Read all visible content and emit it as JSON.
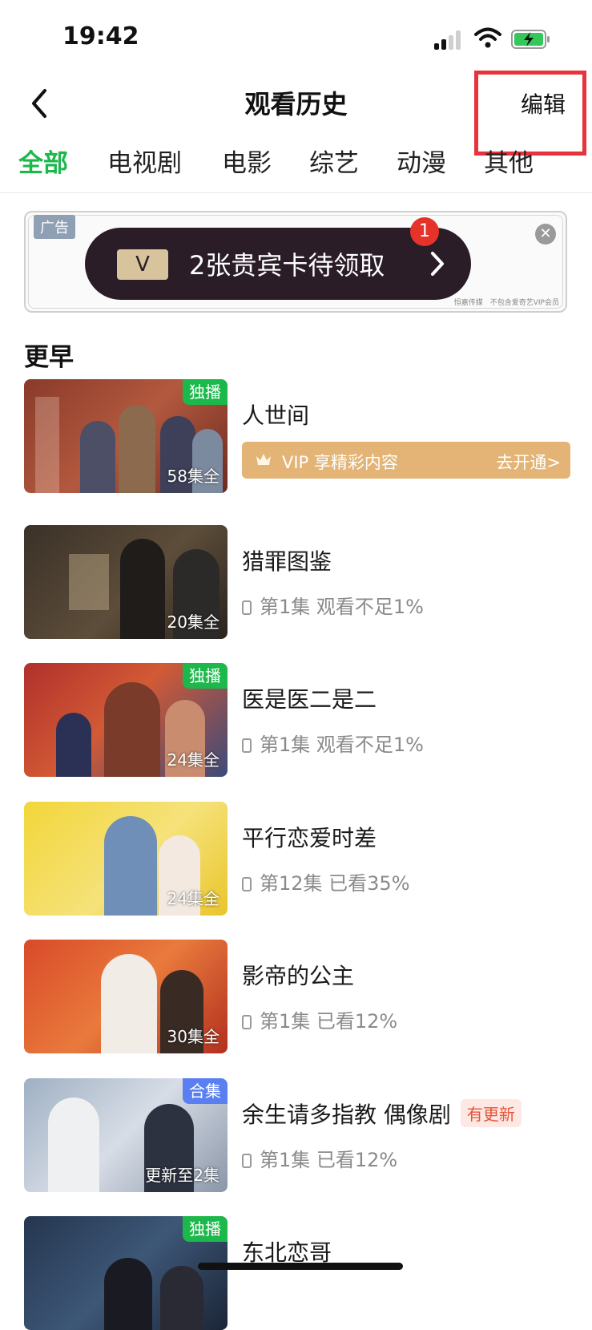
{
  "status_bar": {
    "time": "19:42"
  },
  "nav": {
    "title": "观看历史",
    "edit": "编辑"
  },
  "tabs": [
    {
      "label": "全部",
      "active": true
    },
    {
      "label": "电视剧",
      "active": false
    },
    {
      "label": "电影",
      "active": false
    },
    {
      "label": "综艺",
      "active": false
    },
    {
      "label": "动漫",
      "active": false
    },
    {
      "label": "其他",
      "active": false
    }
  ],
  "ad": {
    "tag": "广告",
    "v_label": "V",
    "text": "2张贵宾卡待领取",
    "badge_count": "1",
    "fine_print": "恒嘉传媒　不包含爱奇艺VIP会员"
  },
  "section_label": "更早",
  "items": [
    {
      "title": "人世间",
      "episodes": "58集全",
      "badge": "独播",
      "vip_text": "VIP 享精彩内容",
      "vip_link": "去开通>"
    },
    {
      "title": "猎罪图鉴",
      "episodes": "20集全",
      "progress": "第1集 观看不足1%"
    },
    {
      "title": "医是医二是二",
      "episodes": "24集全",
      "badge": "独播",
      "progress": "第1集 观看不足1%"
    },
    {
      "title": "平行恋爱时差",
      "episodes": "24集全",
      "progress": "第12集 已看35%"
    },
    {
      "title": "影帝的公主",
      "episodes": "30集全",
      "progress": "第1集 已看12%"
    },
    {
      "title": "余生请多指教 偶像剧",
      "episodes": "更新至2集",
      "badge": "合集",
      "update_tag": "有更新",
      "progress": "第1集 已看12%"
    },
    {
      "title": "东北恋哥",
      "badge": "独播"
    }
  ],
  "colors": {
    "accent": "#1cb84b",
    "vip_gold": "#e3b475",
    "highlight": "#e8323c",
    "ad_pill": "#2a1d27"
  }
}
